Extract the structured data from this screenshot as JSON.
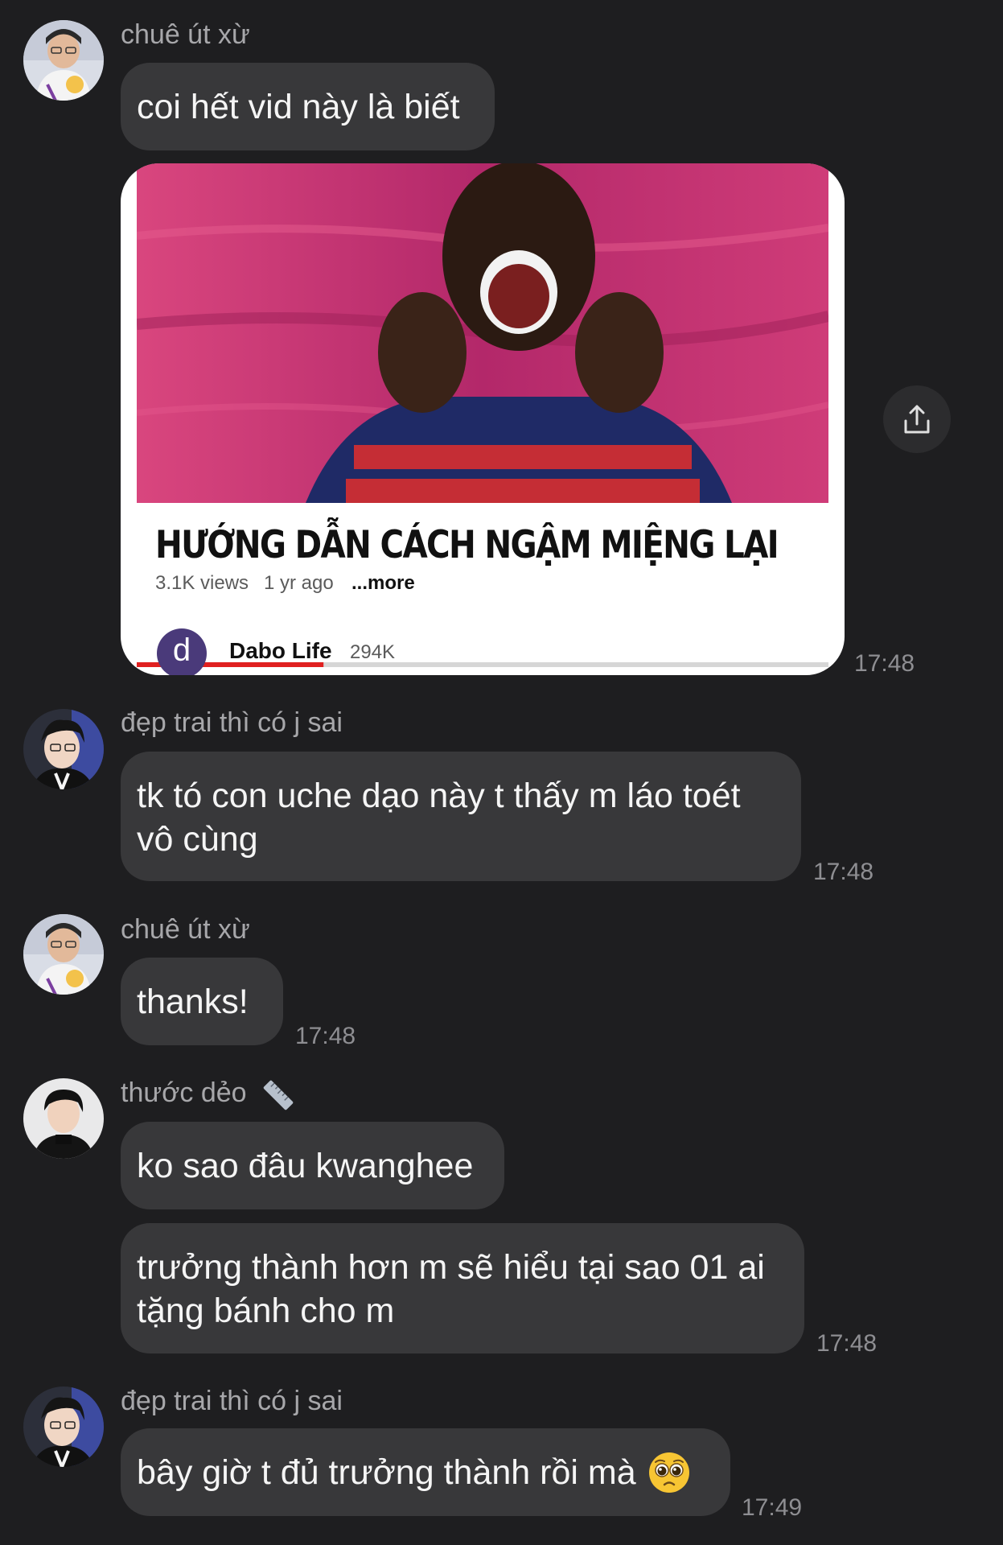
{
  "messages": {
    "m1": {
      "sender": "chuê út xừ",
      "text": "coi hết vid này là biết",
      "time": "17:48"
    },
    "video": {
      "title": "HƯỚNG DẪN CÁCH NGẬM MIỆNG LẠI",
      "views": "3.1K views",
      "age": "1 yr ago",
      "more": "...more",
      "channel_initial": "d",
      "channel_name": "Dabo Life",
      "channel_subs": "294K",
      "progress_fraction": 0.27
    },
    "m2": {
      "sender": "đẹp trai thì có j sai",
      "line1": "tk tó con uche dạo này t thấy m láo toét",
      "line2": "vô cùng",
      "time": "17:48"
    },
    "m3": {
      "sender": "chuê út xừ",
      "text": "thanks!",
      "time": "17:48"
    },
    "m4": {
      "sender": "thước dẻo",
      "text": "ko sao đâu kwanghee",
      "time": ""
    },
    "m5": {
      "line1": "trưởng thành hơn m sẽ hiểu tại sao 01 ai",
      "line2": "tặng bánh cho m",
      "time": "17:48"
    },
    "m6": {
      "sender": "đẹp trai thì có j sai",
      "text": "bây giờ t đủ trưởng thành rồi mà",
      "time": "17:49"
    }
  },
  "icons": {
    "share": "share-icon",
    "ruler": "ruler-icon",
    "pleading": "pleading-face-emoji"
  },
  "colors": {
    "background": "#1e1e20",
    "bubble": "#38383a",
    "sender": "#a7a7aa",
    "time": "#8e8e92",
    "progress": "#e02020"
  }
}
